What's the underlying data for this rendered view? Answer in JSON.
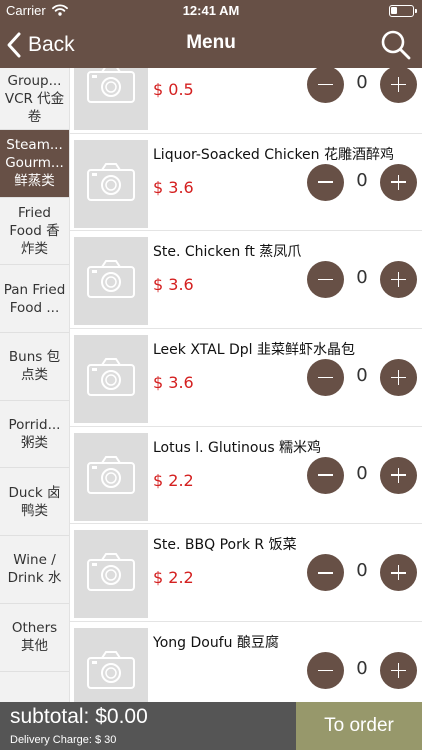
{
  "status_bar": {
    "carrier": "Carrier",
    "time": "12:41 AM",
    "battery_level": 0.3
  },
  "nav": {
    "back_label": "Back",
    "title": "Menu",
    "back_icon": "chevron-left-icon",
    "search_icon": "search-icon"
  },
  "categories": [
    {
      "label": "Group... VCR 代金卷",
      "active": false
    },
    {
      "label": "Steam... Gourm... 鲜蒸类",
      "active": true
    },
    {
      "label": "Fried Food 香炸类",
      "active": false
    },
    {
      "label": "Pan Fried Food ...",
      "active": false
    },
    {
      "label": "Buns 包点类",
      "active": false
    },
    {
      "label": "Porrid... 粥类",
      "active": false
    },
    {
      "label": "Duck 卤鸭类",
      "active": false
    },
    {
      "label": "Wine / Drink 水",
      "active": false
    },
    {
      "label": "Others 其他",
      "active": false
    }
  ],
  "items": [
    {
      "name": "",
      "price": "$ 0.5",
      "qty": "0"
    },
    {
      "name": "Liquor-Soacked Chicken 花雕酒醉鸡",
      "price": "$ 3.6",
      "qty": "0"
    },
    {
      "name": "Ste. Chicken ft 蒸凤爪",
      "price": "$ 3.6",
      "qty": "0"
    },
    {
      "name": "Leek XTAL Dpl 韭菜鲜虾水晶包",
      "price": "$ 3.6",
      "qty": "0"
    },
    {
      "name": "Lotus l. Glutinous 糯米鸡",
      "price": "$ 2.2",
      "qty": "0"
    },
    {
      "name": "Ste. BBQ Pork R 饭菜",
      "price": "$ 2.2",
      "qty": "0"
    },
    {
      "name": "Yong Doufu 酿豆腐",
      "price": "",
      "qty": "0"
    }
  ],
  "footer": {
    "subtotal": "subtotal: $0.00",
    "delivery": "Delivery Charge: $ 30",
    "order_button": "To order"
  },
  "colors": {
    "brand": "#675046",
    "price": "#d42020",
    "order_button": "#97986b",
    "footer": "#555555"
  }
}
